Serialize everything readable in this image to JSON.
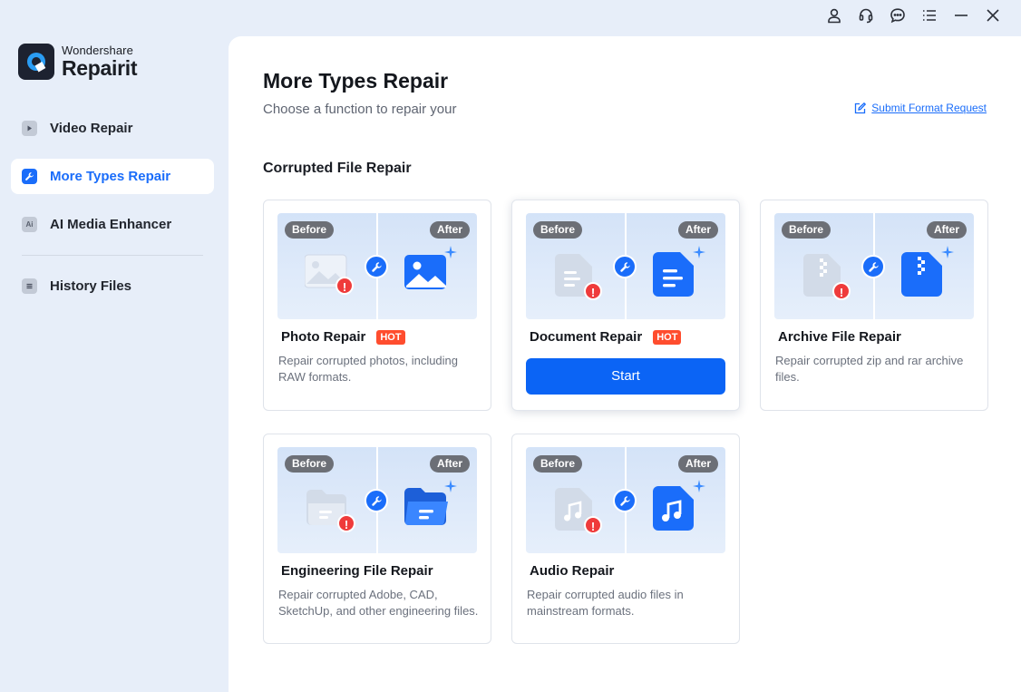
{
  "app": {
    "brand": "Wondershare",
    "product": "Repairit"
  },
  "titlebar": {
    "icons": [
      "account-icon",
      "support-icon",
      "feedback-icon",
      "menu-icon",
      "minimize-icon",
      "close-icon"
    ]
  },
  "sidebar": {
    "items": [
      {
        "label": "Video Repair",
        "icon": "video-icon",
        "active": false
      },
      {
        "label": "More Types Repair",
        "icon": "wrench-icon",
        "active": true
      },
      {
        "label": "AI Media Enhancer",
        "icon": "ai-icon",
        "icon_text": "Ai",
        "active": false
      },
      {
        "label": "History Files",
        "icon": "history-icon",
        "active": false
      }
    ]
  },
  "main": {
    "title": "More Types Repair",
    "subtitle": "Choose a function to repair your",
    "submit_link": "Submit Format Request",
    "section_title": "Corrupted File Repair",
    "badge_before": "Before",
    "badge_after": "After",
    "cards": [
      {
        "title": "Photo Repair",
        "hot": "HOT",
        "desc": "Repair corrupted photos, including RAW formats.",
        "icon": "photo-icon"
      },
      {
        "title": "Document Repair",
        "hot": "HOT",
        "desc": "",
        "start": "Start",
        "icon": "document-icon"
      },
      {
        "title": "Archive File Repair",
        "desc": "Repair corrupted zip and rar archive files.",
        "icon": "archive-icon"
      },
      {
        "title": "Engineering File Repair",
        "desc": "Repair corrupted Adobe, CAD, SketchUp, and other engineering files.",
        "icon": "folder-icon"
      },
      {
        "title": "Audio Repair",
        "desc": "Repair corrupted audio files in mainstream formats.",
        "icon": "audio-icon"
      }
    ]
  },
  "colors": {
    "accent": "#1a6dfa",
    "sidebar_bg": "#e7eef9",
    "hot": "#ff4d2e",
    "error": "#ef3b3b"
  }
}
